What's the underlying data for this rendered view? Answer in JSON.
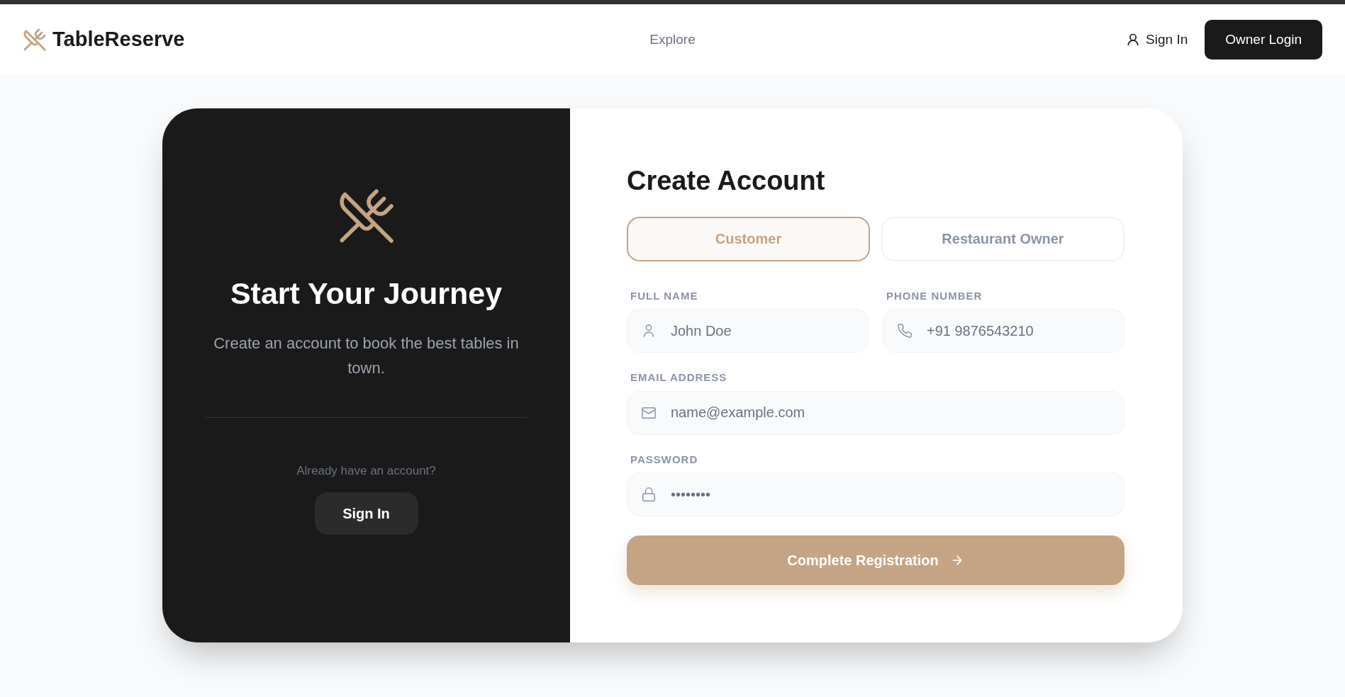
{
  "header": {
    "brand": "TableReserve",
    "nav": [
      {
        "label": "Explore"
      }
    ],
    "sign_in": "Sign In",
    "owner_login": "Owner Login"
  },
  "intro": {
    "title": "Start Your Journey",
    "text": "Create an account to book the best tables in town.",
    "prompt": "Already have an account?",
    "button": "Sign In"
  },
  "form": {
    "title": "Create Account",
    "account_types": [
      {
        "label": "Customer",
        "selected": true
      },
      {
        "label": "Restaurant Owner",
        "selected": false
      }
    ],
    "fields": [
      {
        "kind": "person",
        "label": "FULL NAME",
        "placeholder": "John Doe"
      },
      {
        "kind": "phone",
        "label": "PHONE NUMBER",
        "placeholder": "+91 9876543210"
      },
      {
        "kind": "email",
        "label": "EMAIL ADDRESS",
        "placeholder": "name@example.com"
      },
      {
        "kind": "password",
        "label": "PASSWORD",
        "placeholder": "••••••••"
      }
    ],
    "submit": "Complete Registration"
  }
}
